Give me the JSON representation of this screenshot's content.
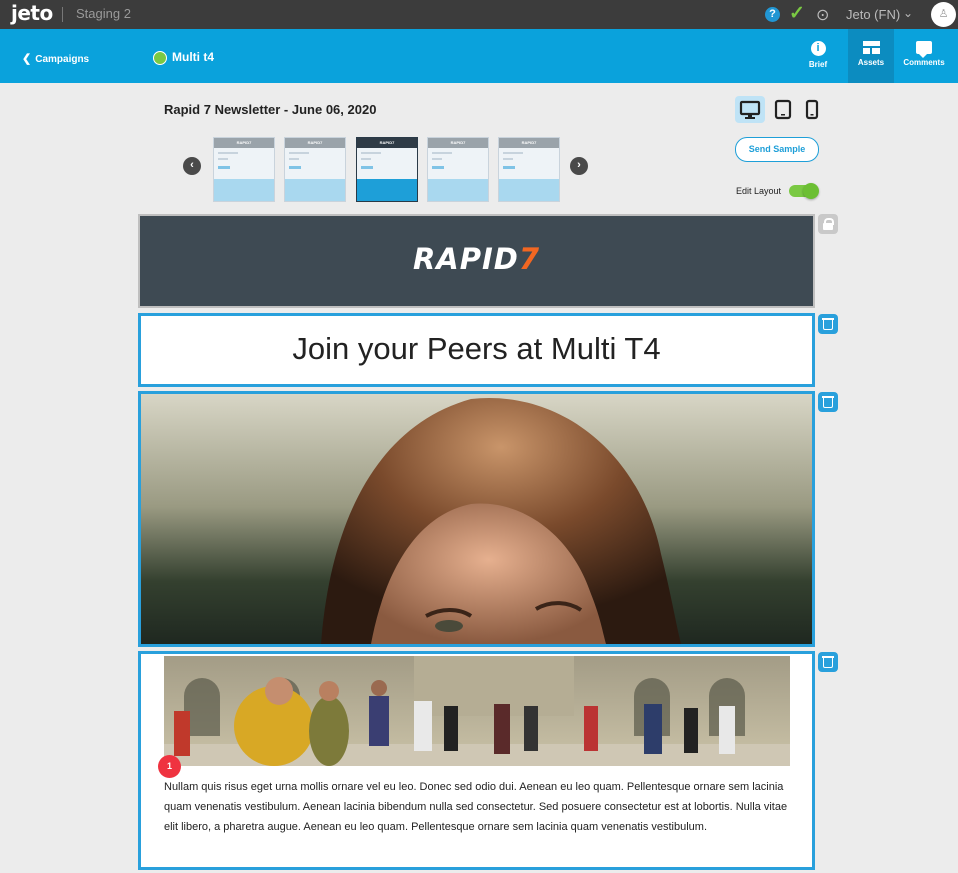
{
  "app": {
    "logo": "jeto",
    "environment": "Staging 2",
    "account": "Jeto (FN)",
    "help_icon": "question-icon",
    "status_icon": "check-icon",
    "target_icon": "target-icon"
  },
  "header": {
    "back_label": "Campaigns",
    "campaign_name": "Multi t4",
    "status_color": "#7ac943",
    "nav": [
      {
        "label": "Brief",
        "icon": "info-icon",
        "active": false
      },
      {
        "label": "Assets",
        "icon": "layout-icon",
        "active": true
      },
      {
        "label": "Comments",
        "icon": "comment-icon",
        "active": false
      }
    ]
  },
  "editor": {
    "newsletter_title": "Rapid 7 Newsletter - June 06, 2020",
    "devices": [
      {
        "name": "desktop",
        "active": true
      },
      {
        "name": "tablet",
        "active": false
      },
      {
        "name": "mobile",
        "active": false
      }
    ],
    "thumbnails": [
      {
        "label": "RAPID7",
        "selected": false
      },
      {
        "label": "RAPID7",
        "selected": false
      },
      {
        "label": "RAPID7",
        "selected": true
      },
      {
        "label": "RAPID7",
        "selected": false
      },
      {
        "label": "RAPID7",
        "selected": false
      }
    ],
    "send_sample_label": "Send Sample",
    "edit_layout_label": "Edit Layout",
    "edit_layout_on": true
  },
  "email": {
    "brand": "RAPID",
    "brand_mark": "7",
    "headline": "Join your Peers at Multi T4",
    "body_text": "Nullam quis risus eget urna mollis ornare vel eu leo. Donec sed odio dui. Aenean eu leo quam. Pellentesque ornare sem lacinia quam venenatis vestibulum. Aenean lacinia bibendum nulla sed consectetur. Sed posuere consectetur est at lobortis. Nulla vitae elit libero, a pharetra augue. Aenean eu leo quam. Pellentesque ornare sem lacinia quam venenatis vestibulum.",
    "comment_count": "1"
  },
  "colors": {
    "topbar": "#3c3c3c",
    "accent": "#0aa2dc",
    "block_border": "#29a0dc",
    "brand_orange": "#f26722",
    "badge": "#ef3340"
  }
}
